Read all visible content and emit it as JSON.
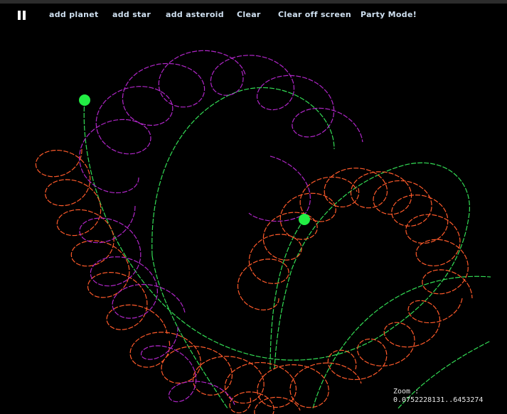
{
  "toolbar": {
    "pause_glyph": "pause-icon",
    "add_planet": "add planet",
    "add_star": "add star",
    "add_asteroid": "add asteroid",
    "clear": "Clear",
    "clear_off_screen": "Clear off screen",
    "party_mode": "Party Mode!"
  },
  "zoom": {
    "label": "Zoom :",
    "value": "0.0752228131..6453274"
  },
  "colors": {
    "background": "#000000",
    "toolbar_strip": "#2c2c2c",
    "toolbar_text": "#cfe0f0",
    "star_body": "#22ee44",
    "star_trail": "#33dd55",
    "planet_trail_orange": "#ff5a2a",
    "planet_trail_purple": "#b026c8"
  },
  "bodies": [
    {
      "type": "star",
      "name": "star-1"
    },
    {
      "type": "star",
      "name": "star-2"
    }
  ]
}
